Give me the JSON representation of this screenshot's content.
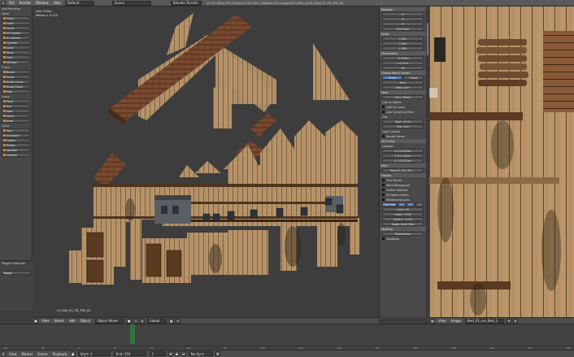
{
  "topbar": {
    "menus": [
      "File",
      "Render",
      "Window",
      "Help"
    ],
    "layout": "Default",
    "scene": "Scene",
    "engine": "Blender Render",
    "stats": "v2.74 | Verts:332 | Faces:2 | Tris:324 | Objects:1/1 | Lamps:0/0 | Mem:4.5M | Bed_01_CB_TRS_02"
  },
  "toolshelf": {
    "add_primitive": "Add Primitive",
    "mesh_label": "Mesh",
    "mesh_items": [
      "Plane",
      "Cube",
      "Circle",
      "UV Sphere",
      "Ico Sphere",
      "Cylinder",
      "Cone",
      "Torus",
      "Grid",
      "Monkey"
    ],
    "curve_label": "Curve",
    "curve_items": [
      "Bezier",
      "Circle",
      "Nurbs Curve",
      "Nurbs Circle",
      "Path"
    ],
    "lamp_label": "Lamp",
    "lamp_items": [
      "Point",
      "Sun",
      "Spot",
      "Hemi",
      "Area"
    ],
    "other_label": "Other",
    "other_items": [
      "Text",
      "Armature",
      "Lattice",
      "Empty",
      "Speaker",
      "Camera"
    ],
    "last_op_title": "Toggle Editmode",
    "last_op_toggle": "Toggle"
  },
  "viewport": {
    "view_name": "User Ortho",
    "units": "Meters x 0.125",
    "object_name": "(1) Bed_01_CB_TRS_02"
  },
  "viewport_header": {
    "items": [
      "View",
      "Select",
      "Add",
      "Object"
    ],
    "mode": "Object Mode",
    "shading": "Global"
  },
  "properties": {
    "rotation_label": "Rotation:",
    "rotation_values": [
      "0°",
      "0°",
      "0°"
    ],
    "rotation_mode": "XYZ Euler",
    "scale_label": "Scale:",
    "scale_values": [
      "1.000",
      "1.000",
      "1.000"
    ],
    "dimensions_label": "Dimensions:",
    "dimensions_values": [
      "17.038m",
      "1.115 m",
      "7m"
    ],
    "grease_pencil": "Grease Pencil Layers",
    "scene_tab": "Scene",
    "object_tab": "Object",
    "new_button": "New",
    "new_layer": "New Layer",
    "view_label": "View",
    "lens_label": "Lens:",
    "lens_value": "35mm",
    "lock_to_object": "Lock to Object:",
    "lock_to_cursor": "Lock to Cursor",
    "lock_camera": "Lock Camera to View",
    "clip_label": "Clip:",
    "clip_start": "Start: 10 cm",
    "clip_end": "End: 1km",
    "local_camera": "Local Camera",
    "render_border": "Render Border",
    "cursor_3d": "3D Cursor",
    "location_label": "Location:",
    "location_values": [
      "X: 2.22218m",
      "Y: 61.1022m",
      "Z: 33.3714m"
    ],
    "item_label": "Item",
    "item_name": "Bed_01_CB_TRS_...",
    "display_label": "Display",
    "display_items": [
      "Only Render",
      "World Background",
      "Outline Selected",
      "All Object Origins",
      "Relationship Lines"
    ],
    "grid_floor": "Grid Floor",
    "grid_axes": [
      "X",
      "Y",
      "Z"
    ],
    "lines_label": "Lines: 16",
    "scale_grid": "Scale: 1.000",
    "subdiv_label": "Subdivi: 0.125",
    "toggle_quad": "Toggle Quad View",
    "shading_label": "Shading",
    "multitexture": "Multitexture",
    "shadeless": "Shadeless"
  },
  "uv_header": {
    "items": [
      "View",
      "Image"
    ],
    "image_name": "Bed_01_sm_Bed_1"
  },
  "timeline": {
    "ticks": [
      "-40",
      "-20",
      "0",
      "20",
      "40",
      "60",
      "80",
      "100",
      "120",
      "140",
      "160",
      "180",
      "200",
      "220",
      "240",
      "260"
    ]
  },
  "bottombar": {
    "items": [
      "View",
      "Marker",
      "Frame",
      "Playback"
    ],
    "start": "Start: 1",
    "end": "End: 250",
    "frame": "1",
    "sync": "No Sync"
  },
  "colors": {
    "wood_light": "#c4a06c",
    "wood_dark": "#6e4a2a",
    "roof": "#7a4a30",
    "accent_blue": "#5680c2"
  }
}
